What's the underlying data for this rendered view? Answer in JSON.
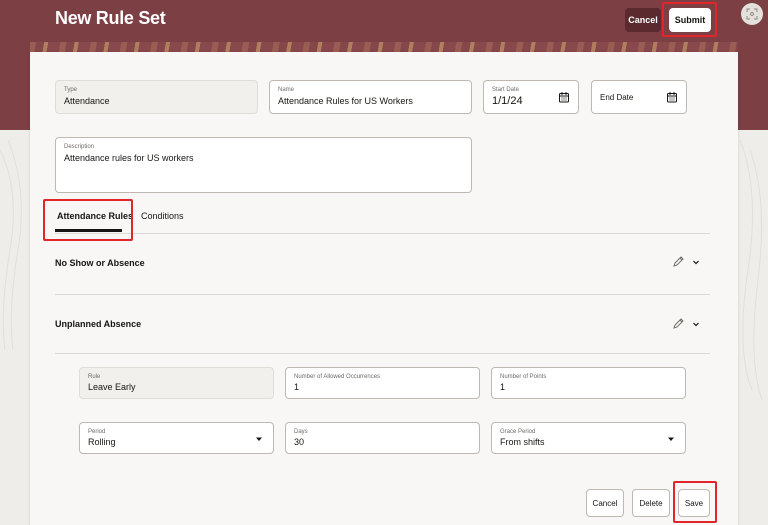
{
  "header": {
    "title": "New Rule Set",
    "cancel_label": "Cancel",
    "submit_label": "Submit"
  },
  "form": {
    "type": {
      "label": "Type",
      "value": "Attendance"
    },
    "name": {
      "label": "Name",
      "value": "Attendance Rules for US Workers"
    },
    "start_date": {
      "label": "Start Date",
      "value": "1/1/24"
    },
    "end_date": {
      "placeholder": "End Date"
    },
    "description": {
      "label": "Description",
      "value": "Attendance rules for US workers"
    }
  },
  "tabs": [
    {
      "label": "Attendance Rules",
      "selected": true
    },
    {
      "label": "Conditions",
      "selected": false
    }
  ],
  "sections": [
    {
      "title": "No Show or Absence"
    },
    {
      "title": "Unplanned Absence"
    }
  ],
  "rule_detail": {
    "rule": {
      "label": "Rule",
      "value": "Leave Early"
    },
    "allowed_occurrences": {
      "label": "Number of Allowed Occurrences",
      "value": "1"
    },
    "points": {
      "label": "Number of Points",
      "value": "1"
    },
    "period": {
      "label": "Period",
      "value": "Rolling"
    },
    "days": {
      "label": "Days",
      "value": "30"
    },
    "grace_period": {
      "label": "Grace Period",
      "value": "From shifts"
    }
  },
  "actions": {
    "cancel_label": "Cancel",
    "delete_label": "Delete",
    "save_label": "Save"
  },
  "colors": {
    "banner": "#7b3f44",
    "highlight": "#e0262a",
    "panel": "#f8f7f5"
  },
  "icons": [
    "calendar-icon",
    "pencil-icon",
    "chevron-down-icon",
    "expand-icon"
  ]
}
